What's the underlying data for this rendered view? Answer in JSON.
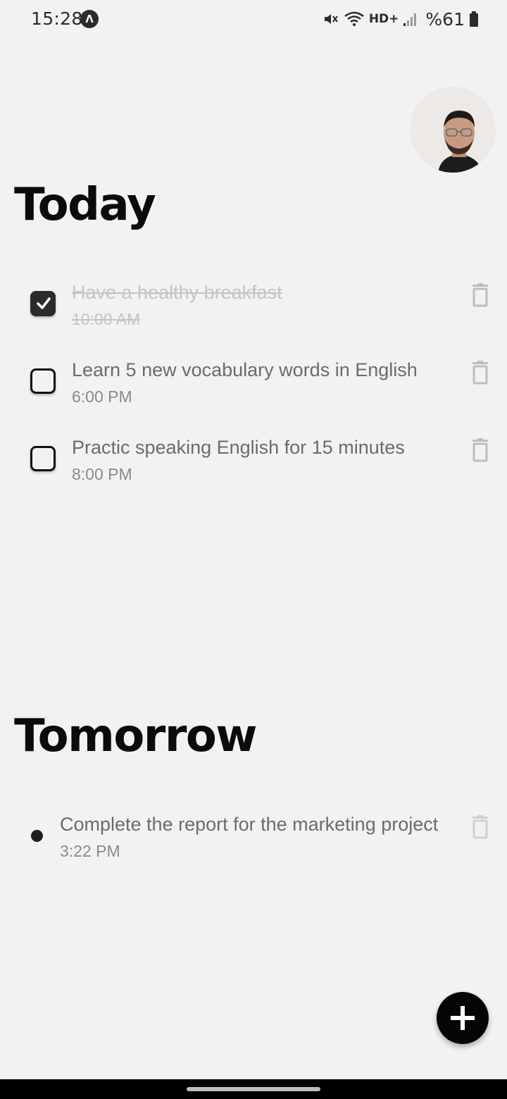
{
  "status_bar": {
    "time": "15:28",
    "network": "HD+",
    "battery": "%61"
  },
  "sections": {
    "today": {
      "title": "Today",
      "tasks": [
        {
          "title": "Have a healthy breakfast",
          "time": "10:00 AM",
          "done": true
        },
        {
          "title": "Learn 5 new vocabulary words in English",
          "time": "6:00 PM",
          "done": false
        },
        {
          "title": "Practic speaking English for 15 minutes",
          "time": "8:00 PM",
          "done": false
        }
      ]
    },
    "tomorrow": {
      "title": "Tomorrow",
      "tasks": [
        {
          "title": "Complete the report for the marketing project",
          "time": "3:22 PM"
        }
      ]
    }
  },
  "icons": {
    "avatar": "user-avatar",
    "trash": "trash-icon",
    "fab": "plus-icon",
    "check": "check-icon"
  },
  "colors": {
    "background": "#f2f2f2",
    "text_primary": "#0b0b0b",
    "text_secondary": "#6b6b6b",
    "fab": "#050505"
  }
}
